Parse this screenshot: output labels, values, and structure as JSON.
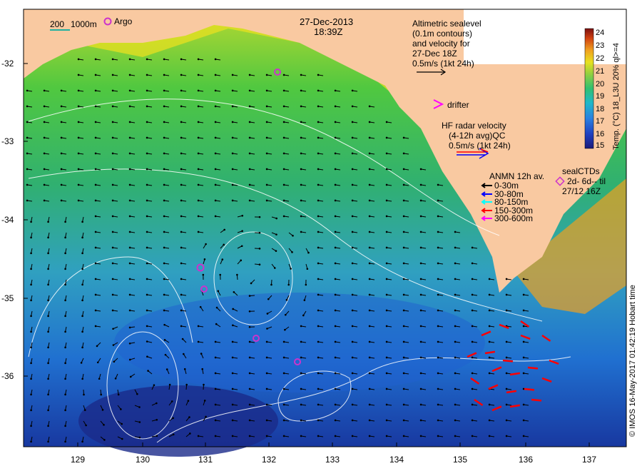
{
  "header": {
    "date": "27-Dec-2013",
    "time": "18:39Z"
  },
  "scale_legend": {
    "label_200": "200",
    "label_1000": "1000m",
    "argo_label": "Argo"
  },
  "altimetry_legend": {
    "lines": [
      "Altimetric sealevel",
      "(0.1m contours)",
      "and velocity for",
      "27-Dec 18Z",
      "0.5m/s (1kt 24h)"
    ]
  },
  "drifter_legend": {
    "label": "drifter"
  },
  "hf_radar_legend": {
    "lines": [
      "HF radar velocity",
      "(4-12h avg)QC",
      "0.5m/s (1kt 24h)"
    ]
  },
  "anmn_legend": {
    "title": "ANMN 12h av.",
    "items": [
      {
        "label": "0-30m",
        "color": "#000000"
      },
      {
        "label": "30-80m",
        "color": "#0000ff"
      },
      {
        "label": "80-150m",
        "color": "#00ffff"
      },
      {
        "label": "150-300m",
        "color": "#ff0000"
      },
      {
        "label": "300-600m",
        "color": "#ff00ff"
      }
    ]
  },
  "sealctd_legend": {
    "title": "sealCTDs",
    "line1": "2d- 6d-- til",
    "line2": "27/12 16Z"
  },
  "colorbar": {
    "label": "Temp. (°C) 18_L3U 20% ql>=4",
    "ticks": [
      "24",
      "23",
      "22",
      "21",
      "20",
      "19",
      "18",
      "17",
      "16",
      "15"
    ]
  },
  "credit": "© IMOS 16-May-2017 01:42:19 Hobart time",
  "axes": {
    "lat_ticks": [
      "-32",
      "-33",
      "-34",
      "-35",
      "-36"
    ],
    "lon_ticks": [
      "129",
      "130",
      "131",
      "132",
      "133",
      "134",
      "135",
      "136",
      "137"
    ]
  },
  "colors": {
    "land": "#f9c9a1",
    "argo": "#cc33cc",
    "hf_radar": "#ff0000",
    "drifter": "#ff00ff"
  }
}
